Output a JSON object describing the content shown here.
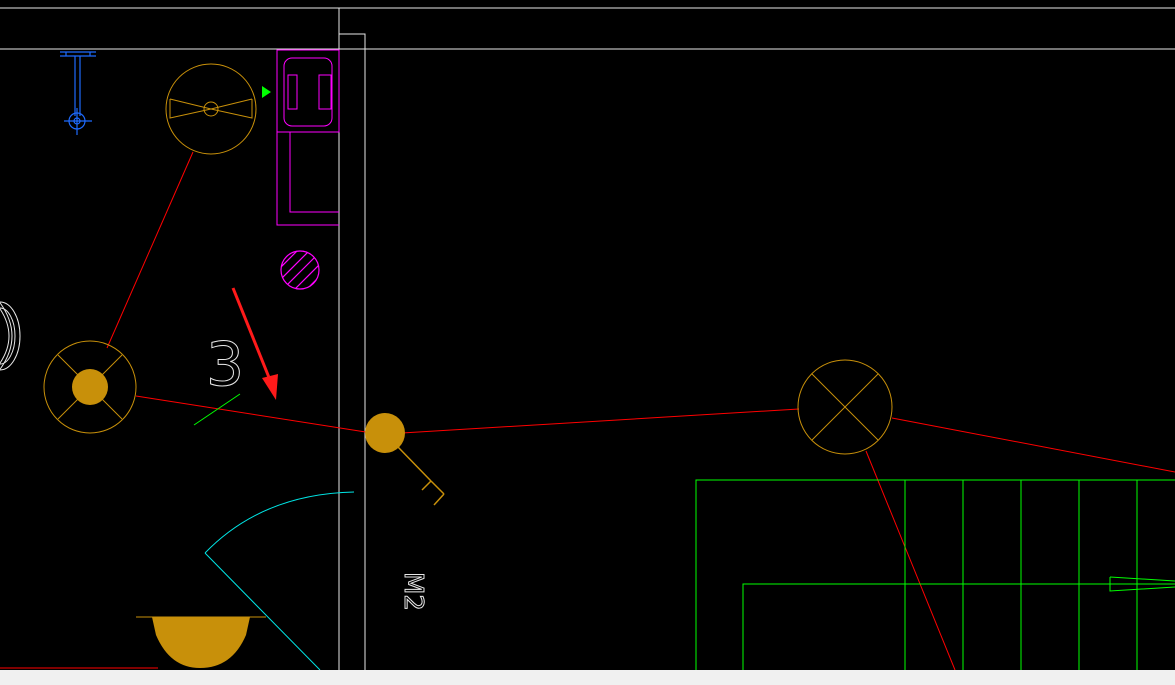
{
  "drawing": {
    "labels": {
      "door_tag": "M2",
      "switch_count": "3"
    },
    "colors": {
      "background": "#000000",
      "wall": "#e8e8e8",
      "wire": "#ff0000",
      "fixture": "#c8900a",
      "stair": "#00ff00",
      "equipment": "#ff00ff",
      "plumbing": "#1e6bff",
      "door_swing": "#00e5e5",
      "annotation_arrow": "#ff1a1a",
      "status_strip": "#f0f0f0"
    },
    "symbols": [
      "exhaust-fan-icon",
      "ceiling-light-icon",
      "switch-icon",
      "cross-light-icon",
      "wall-light-icon",
      "shower-icon",
      "water-heater-icon",
      "floor-drain-icon",
      "red-arrow-icon"
    ]
  }
}
